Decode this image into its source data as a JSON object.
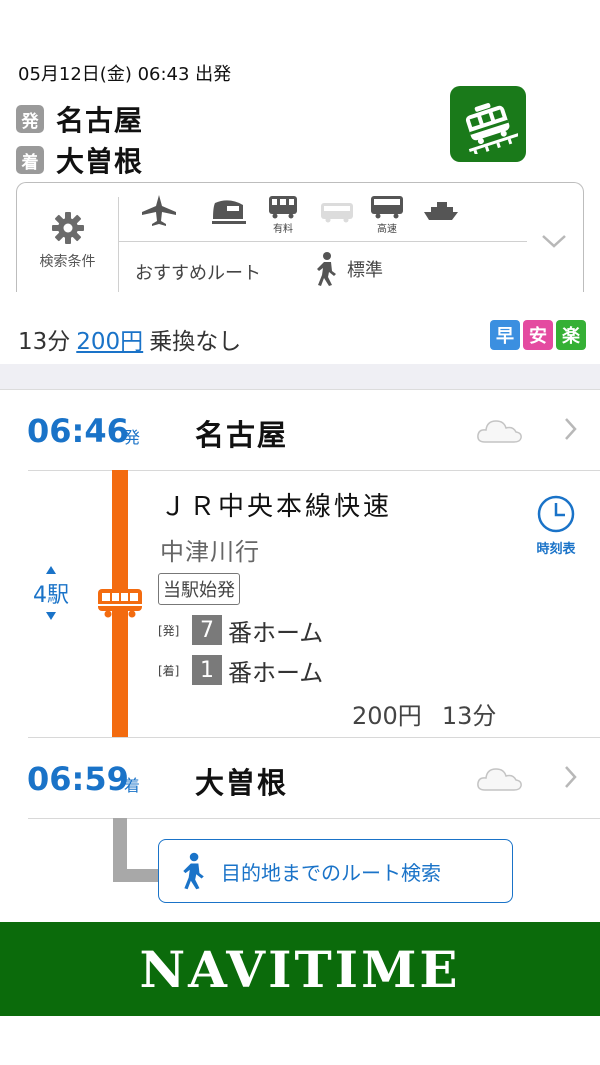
{
  "header": {
    "datetime": "05月12日(金) 06:43 出発",
    "departure": {
      "badge": "発",
      "station": "名古屋"
    },
    "arrival": {
      "badge": "着",
      "station": "大曽根"
    },
    "app_icon": "train-app-icon"
  },
  "conditions": {
    "label": "検索条件",
    "icon": "gear-icon",
    "modes": [
      {
        "icon": "airplane-icon",
        "sub": ""
      },
      {
        "icon": "shinkansen-icon",
        "sub": ""
      },
      {
        "icon": "paid-express-icon",
        "sub": "有料"
      },
      {
        "icon": "local-bus-icon",
        "sub": ""
      },
      {
        "icon": "highway-bus-icon",
        "sub": "高速"
      },
      {
        "icon": "ferry-icon",
        "sub": ""
      }
    ],
    "route_pref": "おすすめルート",
    "walk_pref": "標準"
  },
  "summary": {
    "duration": "13分",
    "fare": "200円",
    "transfers": "乗換なし",
    "tags": [
      {
        "label": "早",
        "color": "#3b8fe0"
      },
      {
        "label": "安",
        "color": "#e44aa0"
      },
      {
        "label": "楽",
        "color": "#35b035"
      }
    ]
  },
  "route": {
    "departure": {
      "time": "06:46",
      "suffix": "発",
      "station": "名古屋"
    },
    "segment": {
      "stops": "4駅",
      "line_color": "#f36b0f",
      "train": "ＪＲ中央本線快速",
      "destination": "中津川行",
      "origin_badge": "当駅始発",
      "dep_platform": {
        "tag": "[発]",
        "num": "7",
        "label": "番ホーム"
      },
      "arr_platform": {
        "tag": "[着]",
        "num": "1",
        "label": "番ホーム"
      },
      "fare": "200円",
      "duration": "13分",
      "timetable_label": "時刻表"
    },
    "arrival": {
      "time": "06:59",
      "suffix": "着",
      "station": "大曽根"
    },
    "dest_search_label": "目的地までのルート検索"
  },
  "footer": {
    "brand": "NAVITIME"
  },
  "colors": {
    "accent": "#1a73c8",
    "brand_green": "#0b6b0b"
  }
}
